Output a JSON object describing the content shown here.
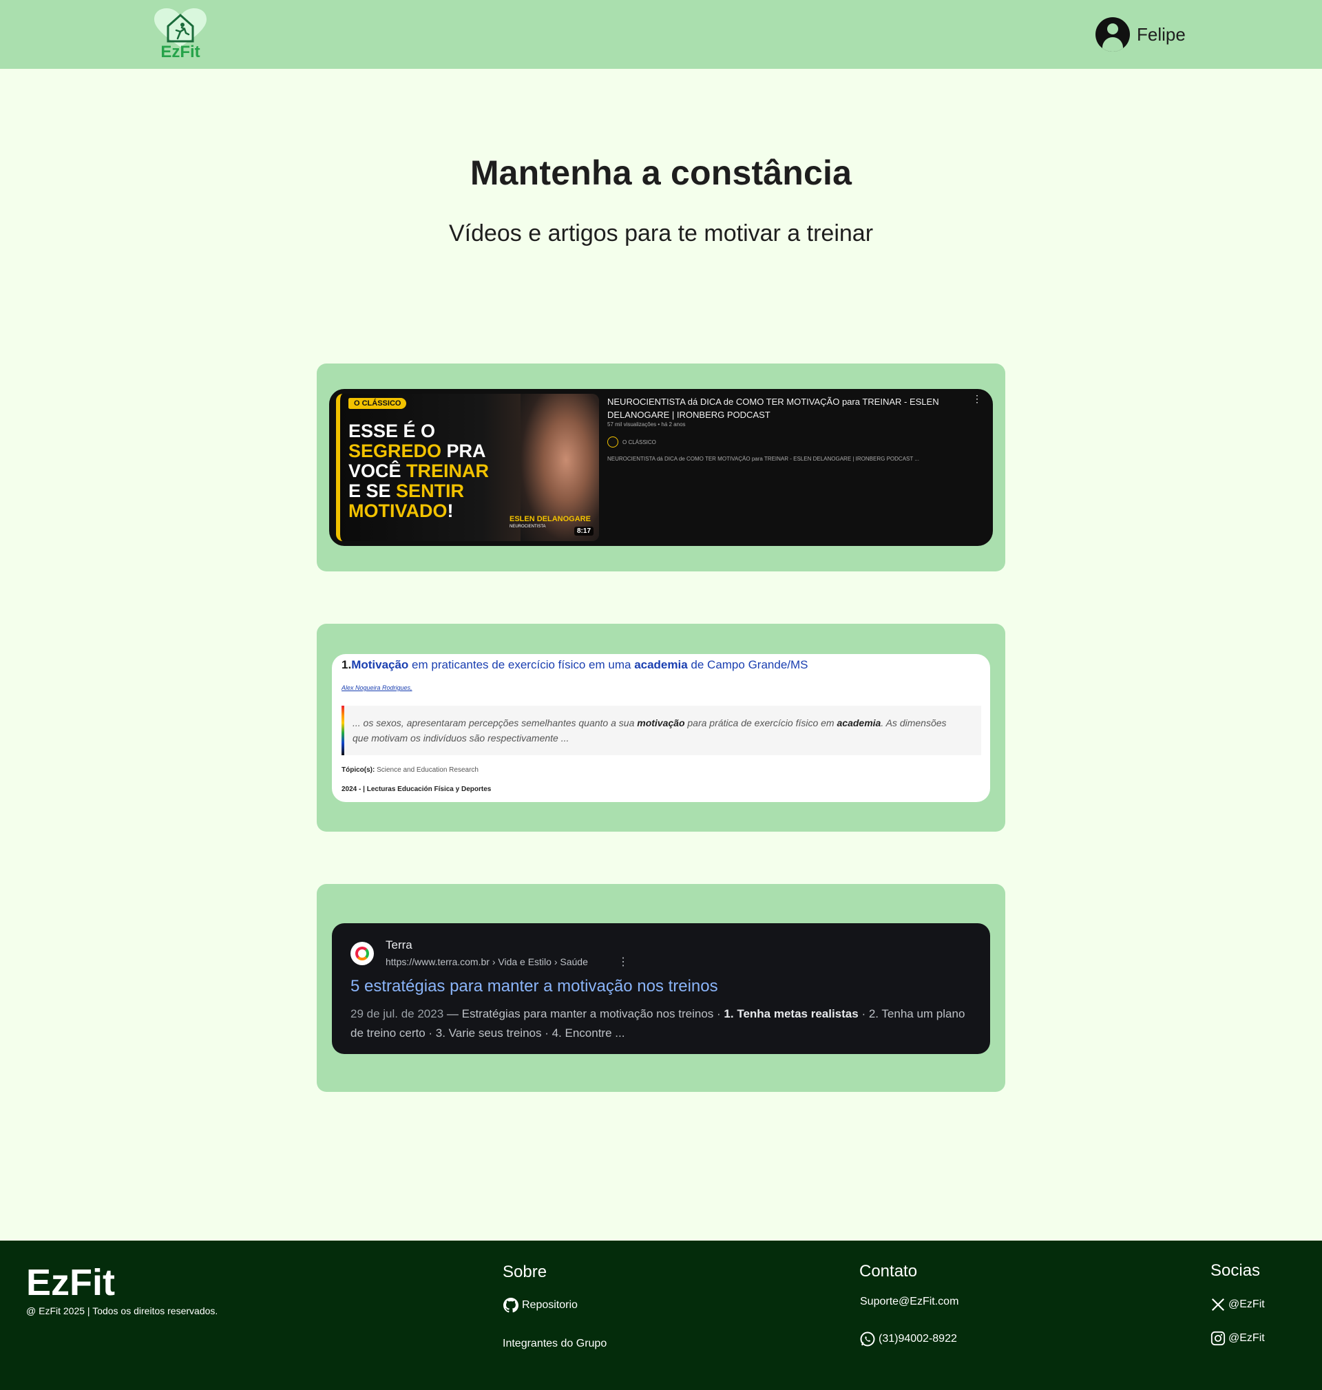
{
  "header": {
    "logo_text": "EzFit",
    "user_name": "Felipe"
  },
  "hero": {
    "title": "Mantenha a constância",
    "subtitle": "Vídeos e artigos para te motivar a treinar"
  },
  "video_card": {
    "thumbnail_badge": "O CLÁSSICO",
    "thumbnail_lines": [
      "ESSE É O",
      "SEGREDO",
      "PRA",
      "VOCÊ",
      "TREINAR",
      "E SE",
      "SENTIR",
      "MOTIVADO",
      "!"
    ],
    "thumbnail_person_name": "ESLEN DELANOGARE",
    "thumbnail_person_role": "NEUROCIENTISTA",
    "duration": "8:17",
    "title": "NEUROCIENTISTA dá DICA de COMO TER MOTIVAÇÃO para TREINAR - ESLEN DELANOGARE | IRONBERG PODCAST",
    "meta": "57 mil visualizações • há 2 anos",
    "channel": "O CLÁSSICO",
    "description": "NEUROCIENTISTA dá DICA de COMO TER MOTIVAÇÃO para TREINAR - ESLEN DELANOGARE | IRONBERG PODCAST ..."
  },
  "article_card": {
    "number": "1.",
    "title_parts": [
      "Motivação",
      " em praticantes de exercício físico em uma ",
      "academia",
      " de Campo Grande/MS"
    ],
    "author": "Alex Nogueira Rodrigues,",
    "quote_parts": [
      "... os sexos, apresentaram percepções semelhantes quanto a sua ",
      "motivação",
      " para prática de exercício físico em ",
      "academia",
      ". As dimensões que motivam os indivíduos são respectivamente ..."
    ],
    "topic_label": "Tópico(s):",
    "topic_value": " Science and Education Research",
    "year_source": "2024 - | Lecturas Educación Física y Deportes"
  },
  "search_card": {
    "site_name": "Terra",
    "url": "https://www.terra.com.br › Vida e Estilo › Saúde",
    "more_icon": "⋮",
    "title": "5 estratégias para manter a motivação nos treinos",
    "date": "29 de jul. de 2023",
    "snippet_a": " — Estratégias para manter a motivação nos treinos · ",
    "snippet_bold": "1. Tenha metas realistas",
    "snippet_b": " · 2. Tenha um plano de treino certo · 3. Varie seus treinos · 4. Encontre ..."
  },
  "footer": {
    "brand": "EzFit",
    "copyright": "@ EzFit 2025 | Todos os direitos reservados.",
    "sobre": {
      "heading": "Sobre",
      "repo": "Repositorio",
      "members": "Integrantes do Grupo"
    },
    "contato": {
      "heading": "Contato",
      "email": "Suporte@EzFit.com",
      "phone": "(31)94002-8922"
    },
    "socias": {
      "heading": "Socias",
      "x": "@EzFit",
      "instagram": "@EzFit"
    }
  },
  "colors": {
    "header_bg": "#aadfae",
    "page_bg": "#f4ffec",
    "card_bg": "#aadfae",
    "footer_bg": "#042c0b",
    "brand_green": "#26a34a",
    "link_blue": "#1a3fb0"
  },
  "icons": {
    "logo": "house-running-person-icon",
    "user": "user-avatar-icon",
    "github": "github-icon",
    "whatsapp": "whatsapp-icon",
    "x": "x-twitter-icon",
    "instagram": "instagram-icon"
  }
}
